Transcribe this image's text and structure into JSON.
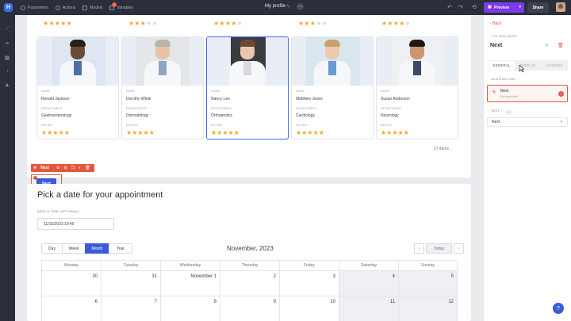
{
  "topbar": {
    "logo": "H",
    "nav": [
      {
        "label": "Parameters",
        "icon": "parameters-icon"
      },
      {
        "label": "Actions",
        "icon": "actions-icon"
      },
      {
        "label": "Models",
        "icon": "models-icon"
      },
      {
        "label": "Variables",
        "icon": "variables-icon",
        "badge": "2"
      }
    ],
    "page_title": "My profile",
    "preview_label": "Preview",
    "share_label": "Share"
  },
  "doctors": [
    {
      "name": "Ronald Jackson",
      "department": "Gastroenterology",
      "rating": 5
    },
    {
      "name": "Dorothy White",
      "department": "Dermatology",
      "rating": 5
    },
    {
      "name": "Nancy Lee",
      "department": "Orthopedics",
      "rating": 5
    },
    {
      "name": "Matthew Jones",
      "department": "Cardiology",
      "rating": 5
    },
    {
      "name": "Susan Anderson",
      "department": "Neurology",
      "rating": 5
    }
  ],
  "top_ratings": [
    5,
    3,
    4,
    3,
    4
  ],
  "card_labels": {
    "name": "NAME",
    "department": "DEPARTMENT",
    "rating": "RATING"
  },
  "items_count": "17 items",
  "element_toolbar": {
    "name": "Next"
  },
  "next_button_label": "Next",
  "date_section": {
    "title": "Pick a date for your appointment",
    "dt_label": "DATE & TIME (OPTIONAL)",
    "dt_value": "11/15/2023 10:45",
    "views": [
      "Day",
      "Week",
      "Month",
      "Year"
    ],
    "active_view": "Month",
    "month_label": "November, 2023",
    "today_label": "Today",
    "weekdays": [
      "Monday",
      "Tuesday",
      "Wednesday",
      "Thursday",
      "Friday",
      "Saturday",
      "Sunday"
    ],
    "week1": [
      "30",
      "31",
      "November 1",
      "2",
      "3",
      "4",
      "5"
    ],
    "week2": [
      "6",
      "7",
      "8",
      "9",
      "10",
      "11",
      "12"
    ]
  },
  "panel": {
    "back_label": "Back",
    "parent_label": "1st step parent",
    "element_name": "Next",
    "tabs": [
      "GENERAL",
      "DISPLAY",
      "ACTIONS"
    ],
    "active_tab": "GENERAL",
    "click_action_label": "CLICK ACTION",
    "action_title": "Next",
    "action_sub": "Not specified",
    "text_label": "TEXT",
    "text_value": "Next"
  },
  "colors": {
    "accent": "#3b5bdb",
    "selection": "#e2583e",
    "preview": "#7c3aed",
    "star": "#f4a92a"
  }
}
